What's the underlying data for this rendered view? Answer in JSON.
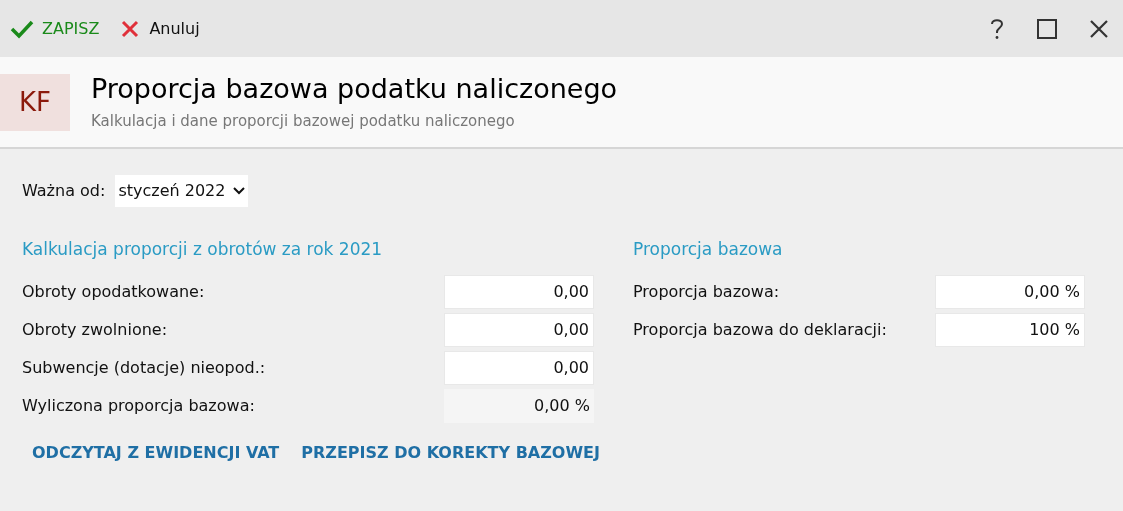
{
  "toolbar": {
    "save": "ZAPISZ",
    "cancel": "Anuluj"
  },
  "header": {
    "badge": "KF",
    "title": "Proporcja bazowa podatku naliczonego",
    "subtitle": "Kalkulacja i dane proporcji bazowej podatku naliczonego"
  },
  "valid_from": {
    "label": "Ważna od:",
    "value": "styczeń 2022"
  },
  "left_section": {
    "heading": "Kalkulacja proporcji z obrotów za rok 2021",
    "fields": [
      {
        "label": "Obroty opodatkowane:",
        "value": "0,00",
        "disabled": false
      },
      {
        "label": "Obroty zwolnione:",
        "value": "0,00",
        "disabled": false
      },
      {
        "label": "Subwencje (dotacje) nieopod.:",
        "value": "0,00",
        "disabled": false
      },
      {
        "label": "Wyliczona proporcja bazowa:",
        "value": "0,00 %",
        "disabled": true
      }
    ],
    "actions": [
      "ODCZYTAJ Z EWIDENCJI VAT",
      "PRZEPISZ DO KOREKTY BAZOWEJ"
    ]
  },
  "right_section": {
    "heading": "Proporcja bazowa",
    "fields": [
      {
        "label": "Proporcja bazowa:",
        "value": "0,00 %",
        "disabled": false
      },
      {
        "label": "Proporcja bazowa do deklaracji:",
        "value": "100 %",
        "disabled": false
      }
    ]
  }
}
